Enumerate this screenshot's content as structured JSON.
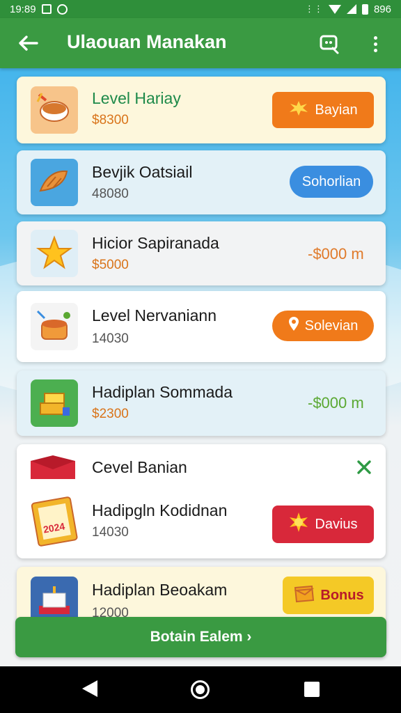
{
  "status_bar": {
    "time": "19:89",
    "right_text": "896"
  },
  "app_bar": {
    "title": "Ulaouan Manakan"
  },
  "list": [
    {
      "title": "Level Hariay",
      "value": "$8300",
      "action": {
        "kind": "button",
        "label": "Bayian",
        "color": "#f07a1a",
        "icon": "burst-icon"
      },
      "title_color": "#1e8a4a",
      "value_color": "#d9741a",
      "bg": "#fdf7dc",
      "thumb": "soup-bowl-icon"
    },
    {
      "title": "Bevjik Oatsiail",
      "value": "48080",
      "action": {
        "kind": "button",
        "label": "Sohorlian",
        "color": "#3a8ee0"
      },
      "title_color": "#1a1a1a",
      "value_color": "#555555",
      "bg": "#e3f1f7",
      "thumb": "croissant-icon"
    },
    {
      "title": "Hicior Sapiranada",
      "value": "$5000",
      "action": {
        "kind": "text",
        "label": "-$000 m",
        "color": "#e07a2a"
      },
      "title_color": "#1a1a1a",
      "value_color": "#d9741a",
      "bg": "#f2f3f4",
      "thumb": "star-icon"
    },
    {
      "title": "Level Nervaniann",
      "value": "14030",
      "action": {
        "kind": "button",
        "label": "Solevian",
        "color": "#f07a1a",
        "icon": "pin-icon"
      },
      "title_color": "#1a1a1a",
      "value_color": "#555555",
      "bg": "#ffffff",
      "thumb": "soup-pot-icon"
    },
    {
      "title": "Hadiplan Sommada",
      "value": "$2300",
      "action": {
        "kind": "text",
        "label": "-$000 m",
        "color": "#5aa832"
      },
      "title_color": "#1a1a1a",
      "value_color": "#d9741a",
      "bg": "#e3f1f7",
      "thumb": "gift-stack-icon"
    }
  ],
  "expanded_card": {
    "header_title": "Cevel Banian",
    "item": {
      "title": "Hadipgln Kodidnan",
      "value": "14030",
      "action": {
        "label": "Davius",
        "color": "#d8283a",
        "icon": "sun-burst-icon"
      },
      "badge_year": "2024"
    }
  },
  "last_card": {
    "title": "Hadiplan Beoakam",
    "value": "12000",
    "action": {
      "label": "Bonus",
      "color": "#f4c926",
      "icon": "envelope-icon"
    }
  },
  "bottom_button": {
    "label": "Botain Ealem ›"
  }
}
